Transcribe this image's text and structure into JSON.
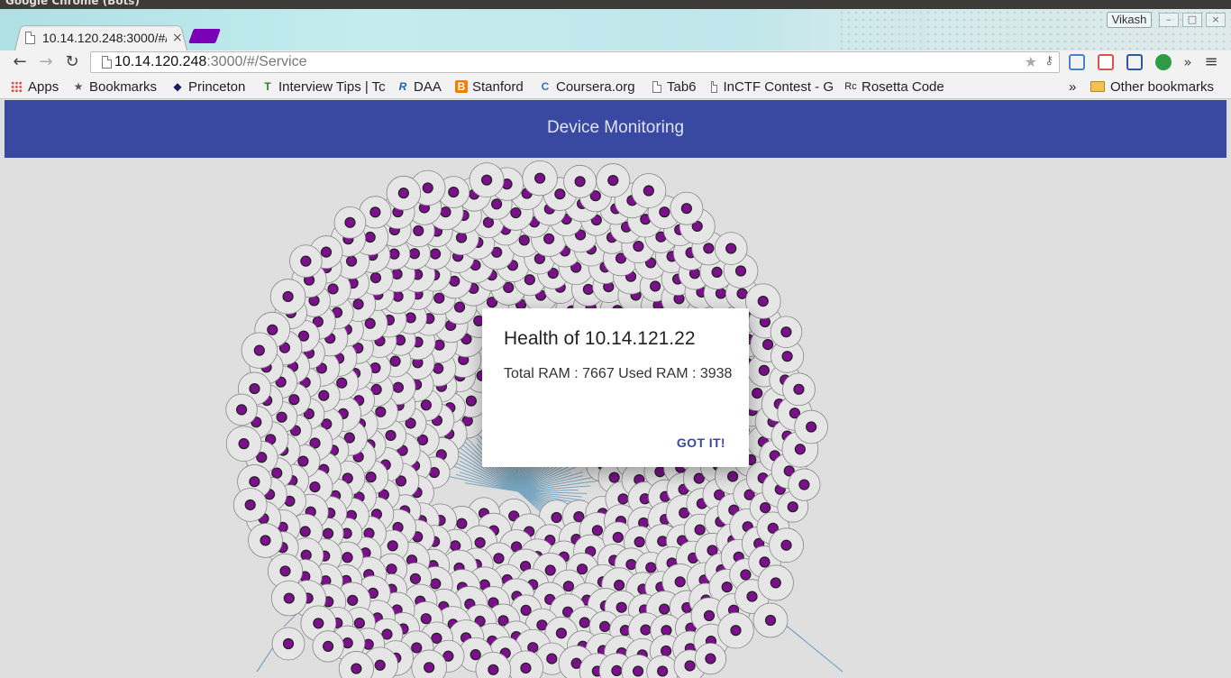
{
  "window": {
    "title": "Google Chrome (Bots)",
    "profile": "Vikash"
  },
  "tab": {
    "title": "10.14.120.248:3000/#/Service",
    "close_glyph": "×"
  },
  "toolbar": {
    "url_host": "10.14.120.248",
    "url_rest": ":3000/#/Service",
    "back_glyph": "←",
    "forward_glyph": "→",
    "reload_glyph": "↻",
    "overflow_glyph": "»",
    "menu_glyph": "≡"
  },
  "bookmarks": {
    "items": [
      {
        "label": "Apps",
        "icon": "apps-grid-icon"
      },
      {
        "label": "Bookmarks",
        "icon": "star-icon"
      },
      {
        "label": "Princeton",
        "icon": "diamond-icon"
      },
      {
        "label": "Interview Tips | Tc",
        "icon": "t-icon"
      },
      {
        "label": "DAA",
        "icon": "r-icon"
      },
      {
        "label": "Stanford",
        "icon": "blogger-icon"
      },
      {
        "label": "Coursera.org",
        "icon": "coursera-icon"
      },
      {
        "label": "Tab6",
        "icon": "page-icon"
      },
      {
        "label": "InCTF Contest - G",
        "icon": "page-icon"
      },
      {
        "label": "Rosetta Code",
        "icon": "rosetta-icon"
      }
    ],
    "overflow": "»",
    "other": "Other bookmarks"
  },
  "app": {
    "title": "Device Monitoring"
  },
  "dialog": {
    "title": "Health of 10.14.121.22",
    "body": "Total RAM : 7667 Used RAM : 3938",
    "button": "GOT IT!"
  },
  "graph": {
    "node_fill": "#e6e6e6",
    "node_stroke": "#888888",
    "core_color": "#7b0f8c",
    "link_color": "#7aa6c0"
  }
}
